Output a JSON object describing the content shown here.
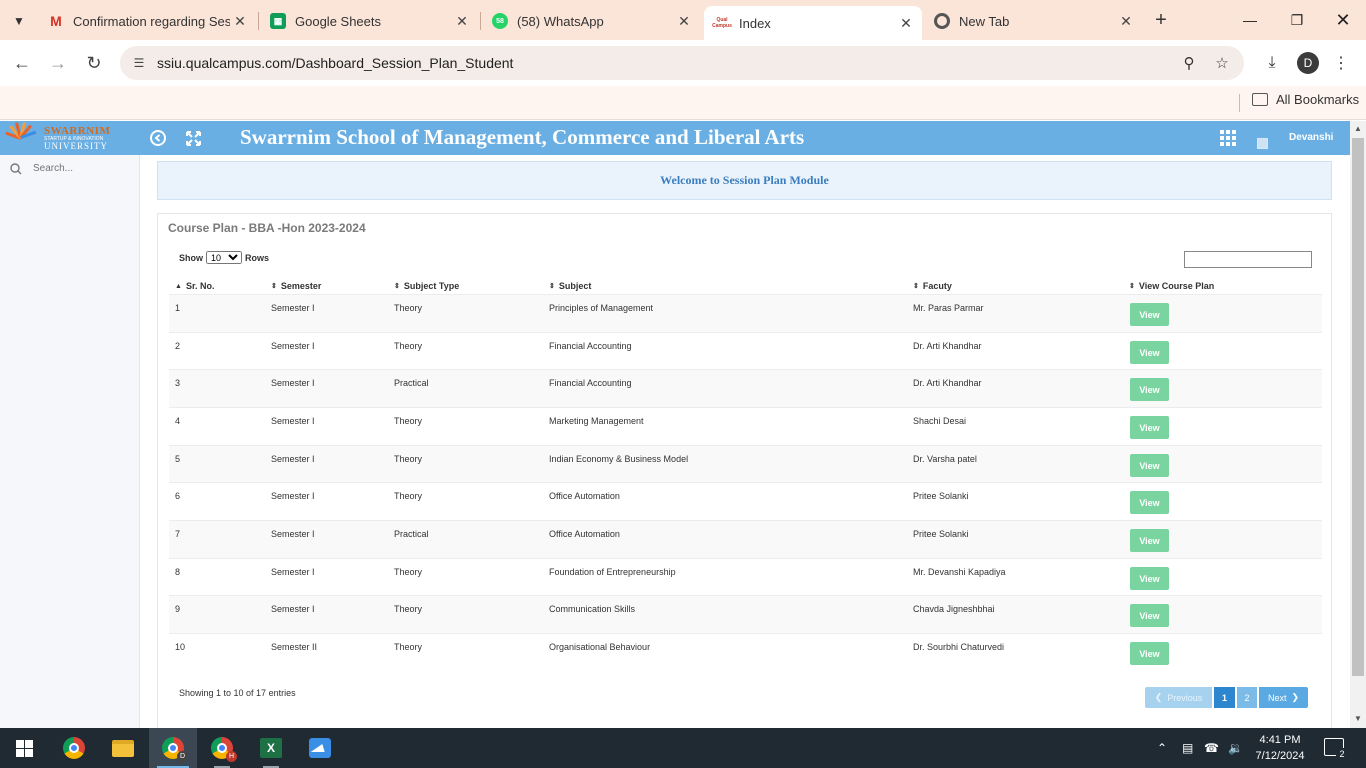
{
  "browser": {
    "tabs": [
      {
        "title": "Confirmation regarding Sess",
        "icon": "gmail-icon"
      },
      {
        "title": "Google Sheets",
        "icon": "sheets-icon"
      },
      {
        "title": "(58) WhatsApp",
        "icon": "whatsapp-icon",
        "badge": "58"
      },
      {
        "title": "Index",
        "icon": "qualcampus-icon",
        "favicon_text": "Qual Campus"
      },
      {
        "title": "New Tab",
        "icon": "chrome-icon"
      }
    ],
    "url": "ssiu.qualcampus.com/Dashboard_Session_Plan_Student",
    "bookmarks_label": "All Bookmarks",
    "profile_initial": "D"
  },
  "app": {
    "logo_text": "SWARRNIM",
    "logo_subtext": "STARTUP & INNOVATION",
    "logo_university": "UNIVERSITY",
    "title": "Swarrnim School of Management, Commerce and Liberal Arts",
    "user_name": "Devanshi",
    "header_color": "#6aafe3"
  },
  "sidebar": {
    "search_placeholder": "Search..."
  },
  "main": {
    "welcome": "Welcome to Session Plan Module",
    "panel_title": "Course Plan - BBA -Hon 2023-2024",
    "show_label": "Show",
    "rows_label": "Rows",
    "rows_selected": "10",
    "columns": [
      "Sr. No.",
      "Semester",
      "Subject Type",
      "Subject",
      "Facuty",
      "View Course Plan"
    ],
    "rows": [
      {
        "sr": "1",
        "semester": "Semester I",
        "type": "Theory",
        "subject": "Principles of Management",
        "faculty": "Mr. Paras Parmar",
        "action": "View"
      },
      {
        "sr": "2",
        "semester": "Semester I",
        "type": "Theory",
        "subject": "Financial Accounting",
        "faculty": "Dr. Arti Khandhar",
        "action": "View"
      },
      {
        "sr": "3",
        "semester": "Semester I",
        "type": "Practical",
        "subject": "Financial Accounting",
        "faculty": "Dr. Arti Khandhar",
        "action": "View"
      },
      {
        "sr": "4",
        "semester": "Semester I",
        "type": "Theory",
        "subject": "Marketing Management",
        "faculty": "Shachi Desai",
        "action": "View"
      },
      {
        "sr": "5",
        "semester": "Semester I",
        "type": "Theory",
        "subject": "Indian Economy & Business Model",
        "faculty": "Dr. Varsha patel",
        "action": "View"
      },
      {
        "sr": "6",
        "semester": "Semester I",
        "type": "Theory",
        "subject": "Office Automation",
        "faculty": "Pritee Solanki",
        "action": "View"
      },
      {
        "sr": "7",
        "semester": "Semester I",
        "type": "Practical",
        "subject": "Office Automation",
        "faculty": "Pritee Solanki",
        "action": "View"
      },
      {
        "sr": "8",
        "semester": "Semester I",
        "type": "Theory",
        "subject": "Foundation of Entrepreneurship",
        "faculty": "Mr. Devanshi Kapadiya",
        "action": "View"
      },
      {
        "sr": "9",
        "semester": "Semester I",
        "type": "Theory",
        "subject": "Communication Skills",
        "faculty": "Chavda Jigneshbhai",
        "action": "View"
      },
      {
        "sr": "10",
        "semester": "Semester II",
        "type": "Theory",
        "subject": "Organisational Behaviour",
        "faculty": "Dr. Sourbhi Chaturvedi",
        "action": "View"
      }
    ],
    "showing": "Showing 1 to 10 of 17 entries",
    "pagination": {
      "previous": "Previous",
      "pages": [
        "1",
        "2"
      ],
      "next": "Next",
      "current": "1"
    },
    "view_button_color": "#7ad4a0"
  },
  "taskbar": {
    "apps": [
      "windows-start",
      "chrome",
      "file-explorer",
      "chrome-profile-d",
      "chrome-profile-h",
      "excel",
      "paint"
    ],
    "profile_badges": [
      "D",
      "H"
    ],
    "time": "4:41 PM",
    "date": "7/12/2024",
    "notifications": "2"
  }
}
